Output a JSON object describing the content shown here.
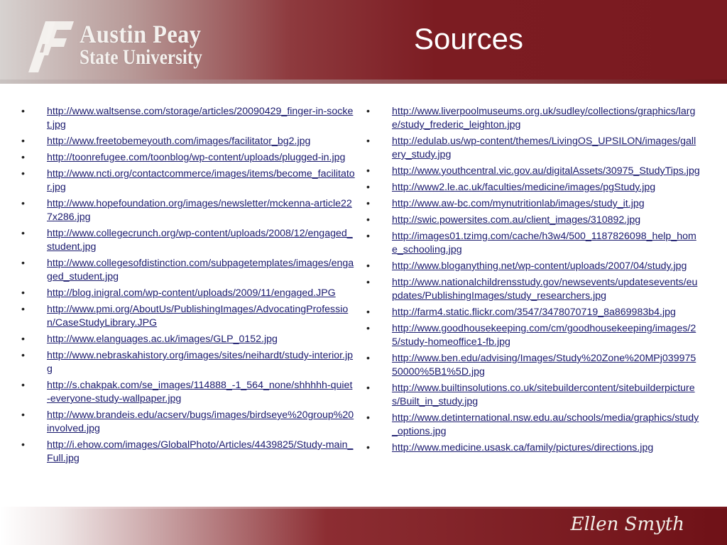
{
  "header": {
    "logo_line1": "Austin Peay",
    "logo_line2": "State University",
    "title": "Sources"
  },
  "footer": {
    "signature": "Ellen Smyth"
  },
  "left_column": [
    "http://www.waltsense.com/storage/articles/20090429_finger-in-socket.jpg",
    "http://www.freetobemeyouth.com/images/facilitator_bg2.jpg",
    "http://toonrefugee.com/toonblog/wp-content/uploads/plugged-in.jpg",
    "http://www.ncti.org/contactcommerce/images/items/become_facilitator.jpg",
    "http://www.hopefoundation.org/images/newsletter/mckenna-article227x286.jpg",
    "http://www.collegecrunch.org/wp-content/uploads/2008/12/engaged_student.jpg",
    "http://www.collegesofdistinction.com/subpagetemplates/images/engaged_student.jpg",
    "http://blog.inigral.com/wp-content/uploads/2009/11/engaged.JPG",
    "http://www.pmi.org/AboutUs/PublishingImages/AdvocatingProfession/CaseStudyLibrary.JPG",
    "http://www.elanguages.ac.uk/images/GLP_0152.jpg",
    "http://www.nebraskahistory.org/images/sites/neihardt/study-interior.jpg",
    "http://s.chakpak.com/se_images/114888_-1_564_none/shhhhh-quiet-everyone-study-wallpaper.jpg",
    "http://www.brandeis.edu/acserv/bugs/images/birdseye%20group%20involved.jpg",
    "http://i.ehow.com/images/GlobalPhoto/Articles/4439825/Study-main_Full.jpg"
  ],
  "right_column": [
    "http://www.liverpoolmuseums.org.uk/sudley/collections/graphics/large/study_frederic_leighton.jpg",
    "http://edulab.us/wp-content/themes/LivingOS_UPSILON/images/gallery_study.jpg",
    "http://www.youthcentral.vic.gov.au/digitalAssets/30975_StudyTips.jpg",
    "http://www2.le.ac.uk/faculties/medicine/images/pgStudy.jpg",
    "http://www.aw-bc.com/mynutritionlab/images/study_it.jpg",
    "http://swic.powersites.com.au/client_images/310892.jpg",
    "http://images01.tzimg.com/cache/h3w4/500_1187826098_help_home_schooling.jpg",
    "http://www.bloganything.net/wp-content/uploads/2007/04/study.jpg",
    "http://www.nationalchildrensstudy.gov/newsevents/updatesevents/eupdates/PublishingImages/study_researchers.jpg",
    "http://farm4.static.flickr.com/3547/3478070719_8a869983b4.jpg",
    "http://www.goodhousekeeping.com/cm/goodhousekeeping/images/25/study-homeoffice1-fb.jpg",
    "http://www.ben.edu/advising/Images/Study%20Zone%20MPj03997550000%5B1%5D.jpg",
    "http://www.builtinsolutions.co.uk/sitebuildercontent/sitebuilderpictures/Built_in_study.jpg",
    "http://www.detinternational.nsw.edu.au/schools/media/graphics/study_options.jpg",
    "http://www.medicine.usask.ca/family/pictures/directions.jpg"
  ]
}
